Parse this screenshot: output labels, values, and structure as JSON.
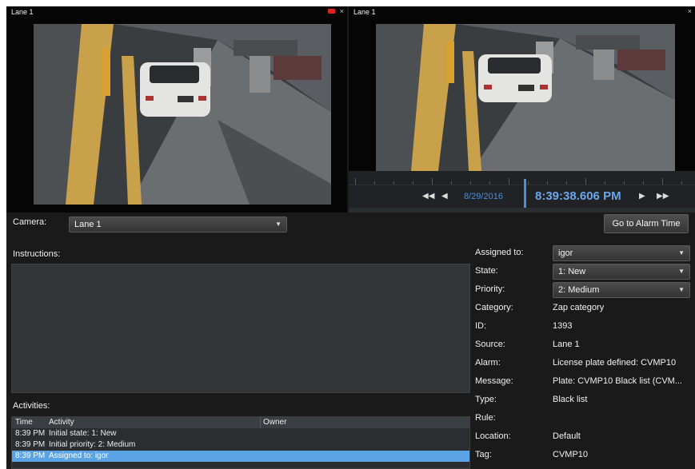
{
  "left_pane": {
    "title": "Lane 1"
  },
  "right_pane": {
    "title": "Lane 1"
  },
  "playback": {
    "date": "8/29/2016",
    "time": "8:39:38.606 PM"
  },
  "camera": {
    "label": "Camera:",
    "value": "Lane 1"
  },
  "go_to_alarm_label": "Go to Alarm Time",
  "instructions_label": "Instructions:",
  "activities": {
    "label": "Activities:",
    "columns": [
      "Time",
      "Activity",
      "Owner"
    ],
    "rows": [
      {
        "time": "8:39 PM",
        "activity": "Initial state: 1: New",
        "owner": ""
      },
      {
        "time": "8:39 PM",
        "activity": "Initial priority: 2: Medium",
        "owner": ""
      },
      {
        "time": "8:39 PM",
        "activity": "Assigned to: igor",
        "owner": ""
      }
    ]
  },
  "details": {
    "assigned_to": {
      "label": "Assigned to:",
      "value": "igor"
    },
    "state": {
      "label": "State:",
      "value": "1: New"
    },
    "priority": {
      "label": "Priority:",
      "value": "2: Medium"
    },
    "category": {
      "label": "Category:",
      "value": "Zap category"
    },
    "id": {
      "label": "ID:",
      "value": "1393"
    },
    "source": {
      "label": "Source:",
      "value": "Lane 1"
    },
    "alarm": {
      "label": "Alarm:",
      "value": "License plate defined: CVMP10"
    },
    "message": {
      "label": "Message:",
      "value": "Plate: CVMP10   Black list (CVM..."
    },
    "type": {
      "label": "Type:",
      "value": "Black list"
    },
    "rule": {
      "label": "Rule:",
      "value": ""
    },
    "location": {
      "label": "Location:",
      "value": "Default"
    },
    "tag": {
      "label": "Tag:",
      "value": "CVMP10"
    }
  },
  "colors": {
    "background": "#1a1a1a",
    "accent": "#4a90d9",
    "selection": "#5aa4e6",
    "record": "#d22222"
  }
}
